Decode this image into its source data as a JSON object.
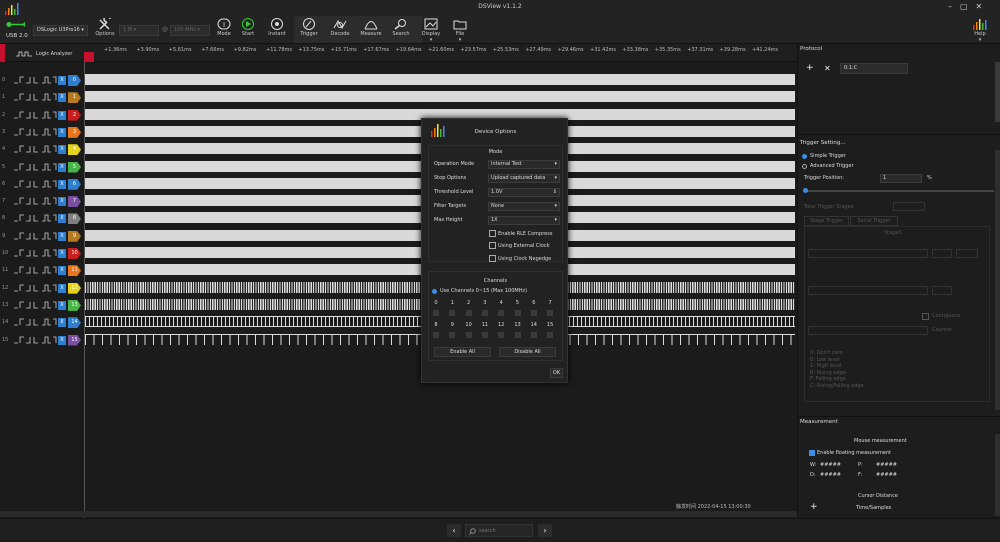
{
  "app": {
    "title": "DSView v1.1.2",
    "device": "DSLogic U3Pro16",
    "usb_label": "USB 2.0",
    "help_label": "Help"
  },
  "toolbar": {
    "options": "Options",
    "sample_count": "1 M",
    "sample_rate": "100 MHz",
    "mode": "Mode",
    "start": "Start",
    "instant": "Instant",
    "trigger": "Trigger",
    "decode": "Decode",
    "measure": "Measure",
    "search": "Search",
    "display": "Display",
    "file": "File"
  },
  "ruler": {
    "label": "Logic Analyzer",
    "ticks": [
      "+1.36ms",
      "+3.90ms",
      "+5.61ms",
      "+7.66ms",
      "+9.82ms",
      "+11.78ms",
      "+13.75ms",
      "+15.71ms",
      "+17.67ms",
      "+19.64ms",
      "+21.60ms",
      "+23.57ms",
      "+25.53ms",
      "+27.49ms",
      "+29.46ms",
      "+31.42ms",
      "+33.38ms",
      "+35.35ms",
      "+37.31ms",
      "+39.28ms",
      "+41.24ms"
    ]
  },
  "channels": [
    {
      "index": "0",
      "color": "#2f7fd1",
      "style": "solid"
    },
    {
      "index": "1",
      "color": "#b57a1f",
      "style": "solid"
    },
    {
      "index": "2",
      "color": "#c81e1e",
      "style": "solid"
    },
    {
      "index": "3",
      "color": "#e8741c",
      "style": "solid"
    },
    {
      "index": "4",
      "color": "#e5d21d",
      "style": "solid"
    },
    {
      "index": "5",
      "color": "#49b548",
      "style": "solid"
    },
    {
      "index": "6",
      "color": "#2f7fd1",
      "style": "solid"
    },
    {
      "index": "7",
      "color": "#7b4fa0",
      "style": "solid"
    },
    {
      "index": "8",
      "color": "#808080",
      "style": "solid"
    },
    {
      "index": "9",
      "color": "#b57a1f",
      "style": "solid"
    },
    {
      "index": "10",
      "color": "#c81e1e",
      "style": "solid"
    },
    {
      "index": "11",
      "color": "#e8741c",
      "style": "solid"
    },
    {
      "index": "12",
      "color": "#e5d21d",
      "style": "dense"
    },
    {
      "index": "13",
      "color": "#49b548",
      "style": "dense"
    },
    {
      "index": "14",
      "color": "#2f7fd1",
      "style": "medium"
    },
    {
      "index": "15",
      "color": "#7b4fa0",
      "style": "pulse"
    }
  ],
  "protocol": {
    "title": "Protocol",
    "selected": "0:1:C"
  },
  "trigger_panel": {
    "title": "Trigger Setting...",
    "simple": "Simple Trigger",
    "advanced": "Advanced Trigger",
    "position_label": "Trigger Position:",
    "position_value": "1",
    "position_unit": "%",
    "total_stages": "Total Trigger Stages:",
    "stage_tab": "Stage Trigger",
    "serial_tab": "Serial Trigger",
    "stage_label": "Stage0",
    "contiguous": "Contiguous",
    "counter": "Counter",
    "legend": [
      "X: Don't care",
      "0: Low level",
      "1: High level",
      "R: Rising edge",
      "F: Falling edge",
      "C: Rising/Falling edge"
    ]
  },
  "measurement": {
    "title": "Measurement",
    "mouse_title": "Mouse measurement",
    "enable_floating": "Enable floating measurement",
    "w_label": "W:",
    "w_value": "#####",
    "p_label": "P:",
    "p_value": "#####",
    "d_label": "D:",
    "d_value": "#####",
    "f_label": "F:",
    "f_value": "#####",
    "cursor_title": "Cursor Distance",
    "time_samples": "Time/Samples"
  },
  "dialog": {
    "title": "Device Options",
    "mode_section": "Mode",
    "operation_mode_label": "Operation Mode",
    "operation_mode": "Internal Test",
    "stop_options_label": "Stop Options",
    "stop_options": "Upload captured data",
    "threshold_label": "Threshold Level",
    "threshold": "1.0V",
    "filter_label": "Filter Targets",
    "filter": "None",
    "max_height_label": "Max Height",
    "max_height": "1X",
    "rle": "Enable RLE Compress",
    "ext_clock": "Using External Clock",
    "clock_neg": "Using Clock Negedge",
    "channels_section": "Channels",
    "use_channels": "Use Channels 0~15 (Max 100MHz)",
    "row1": [
      "0",
      "1",
      "2",
      "3",
      "4",
      "5",
      "6",
      "7"
    ],
    "row2": [
      "8",
      "9",
      "10",
      "11",
      "12",
      "13",
      "14",
      "15"
    ],
    "enable_all": "Enable All",
    "disable_all": "Disable All",
    "ok": "OK"
  },
  "status": {
    "trigger_time": "触发时间 2022-04-15 13:00:30"
  },
  "search": {
    "placeholder": "search"
  }
}
